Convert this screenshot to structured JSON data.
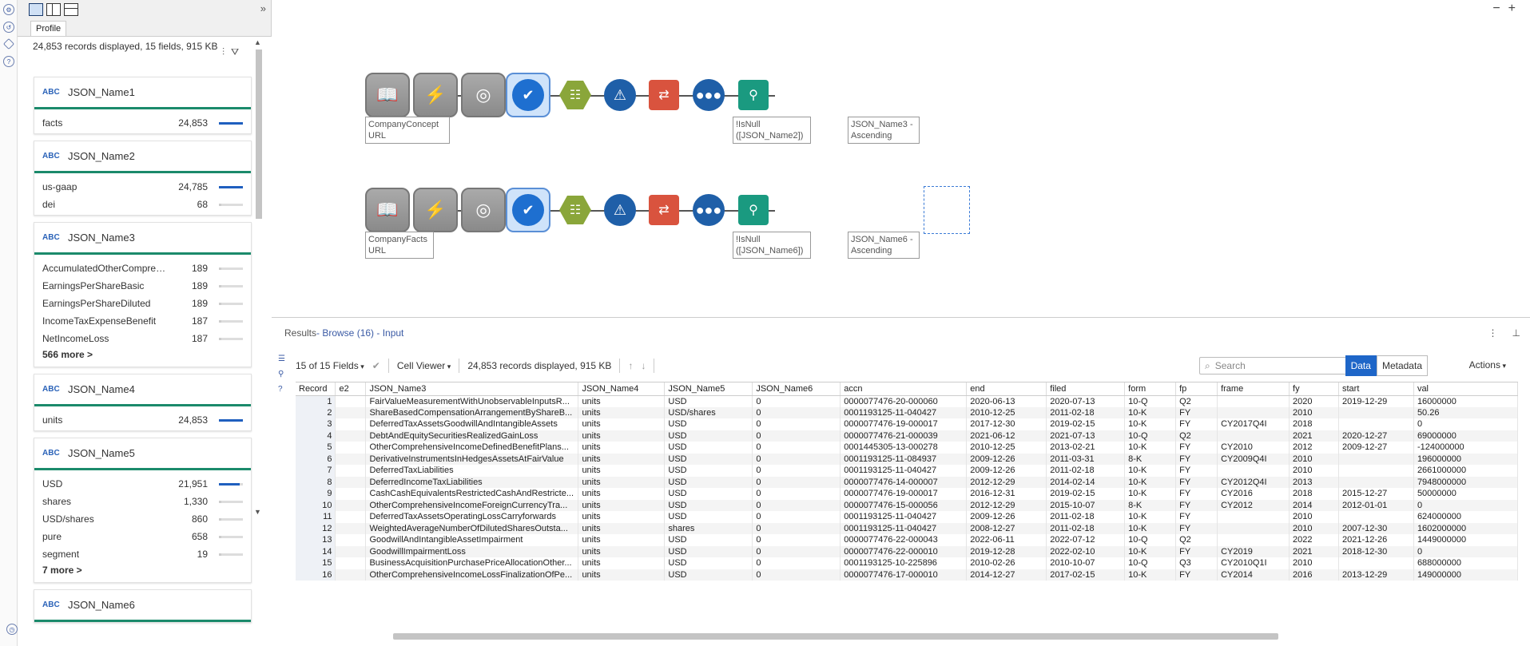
{
  "left_panel": {
    "tab": "Profile",
    "summary": "24,853 records displayed, 15 fields, 915 KB",
    "cards": [
      {
        "name": "JSON_Name1",
        "rows": [
          {
            "label": "facts",
            "count": "24,853",
            "pct": 1.0
          }
        ]
      },
      {
        "name": "JSON_Name2",
        "rows": [
          {
            "label": "us-gaap",
            "count": "24,785",
            "pct": 0.99
          },
          {
            "label": "dei",
            "count": "68",
            "pct": 0.1
          }
        ]
      },
      {
        "name": "JSON_Name3",
        "rows": [
          {
            "label": "AccumulatedOtherComprehens...",
            "count": "189",
            "pct": 0.1
          },
          {
            "label": "EarningsPerShareBasic",
            "count": "189",
            "pct": 0.1
          },
          {
            "label": "EarningsPerShareDiluted",
            "count": "189",
            "pct": 0.1
          },
          {
            "label": "IncomeTaxExpenseBenefit",
            "count": "187",
            "pct": 0.1
          },
          {
            "label": "NetIncomeLoss",
            "count": "187",
            "pct": 0.1
          }
        ],
        "more": "566 more >"
      },
      {
        "name": "JSON_Name4",
        "rows": [
          {
            "label": "units",
            "count": "24,853",
            "pct": 1.0
          }
        ]
      },
      {
        "name": "JSON_Name5",
        "rows": [
          {
            "label": "USD",
            "count": "21,951",
            "pct": 0.88
          },
          {
            "label": "shares",
            "count": "1,330",
            "pct": 0.1
          },
          {
            "label": "USD/shares",
            "count": "860",
            "pct": 0.1
          },
          {
            "label": "pure",
            "count": "658",
            "pct": 0.1
          },
          {
            "label": "segment",
            "count": "19",
            "pct": 0.1
          }
        ],
        "more": "7 more >"
      },
      {
        "name": "JSON_Name6",
        "rows": []
      }
    ]
  },
  "canvas": {
    "labels": {
      "t1": "CompanyConcept URL",
      "t2": "!IsNull ([JSON_Name2])",
      "t3": "JSON_Name3 - Ascending",
      "t4": "CompanyFacts URL",
      "t5": "!IsNull ([JSON_Name6])",
      "t6": "JSON_Name6 - Ascending"
    },
    "zoom_out": "−",
    "zoom_in": "+"
  },
  "results": {
    "title": "Results",
    "subtitle": " - Browse (16) - Input",
    "fields_selector": "15 of 15 Fields",
    "cell_viewer": "Cell Viewer",
    "records_info": "24,853 records displayed, 915 KB",
    "search_placeholder": "Search",
    "data_btn": "Data",
    "metadata_btn": "Metadata",
    "actions_btn": "Actions",
    "columns": [
      "Record",
      "e2",
      "JSON_Name3",
      "JSON_Name4",
      "JSON_Name5",
      "JSON_Name6",
      "accn",
      "end",
      "filed",
      "form",
      "fp",
      "frame",
      "fy",
      "start",
      "val"
    ],
    "rows": [
      [
        "1",
        "",
        "FairValueMeasurementWithUnobservableInputsR...",
        "units",
        "USD",
        "0",
        "0000077476-20-000060",
        "2020-06-13",
        "2020-07-13",
        "10-Q",
        "Q2",
        "",
        "2020",
        "2019-12-29",
        "16000000"
      ],
      [
        "2",
        "",
        "ShareBasedCompensationArrangementByShareB...",
        "units",
        "USD/shares",
        "0",
        "0001193125-11-040427",
        "2010-12-25",
        "2011-02-18",
        "10-K",
        "FY",
        "",
        "2010",
        "",
        "50.26"
      ],
      [
        "3",
        "",
        "DeferredTaxAssetsGoodwillAndIntangibleAssets",
        "units",
        "USD",
        "0",
        "0000077476-19-000017",
        "2017-12-30",
        "2019-02-15",
        "10-K",
        "FY",
        "CY2017Q4I",
        "2018",
        "",
        "0"
      ],
      [
        "4",
        "",
        "DebtAndEquitySecuritiesRealizedGainLoss",
        "units",
        "USD",
        "0",
        "0000077476-21-000039",
        "2021-06-12",
        "2021-07-13",
        "10-Q",
        "Q2",
        "",
        "2021",
        "2020-12-27",
        "69000000"
      ],
      [
        "5",
        "",
        "OtherComprehensiveIncomeDefinedBenefitPlans...",
        "units",
        "USD",
        "0",
        "0001445305-13-000278",
        "2010-12-25",
        "2013-02-21",
        "10-K",
        "FY",
        "CY2010",
        "2012",
        "2009-12-27",
        "-124000000"
      ],
      [
        "6",
        "",
        "DerivativeInstrumentsInHedgesAssetsAtFairValue",
        "units",
        "USD",
        "0",
        "0001193125-11-084937",
        "2009-12-26",
        "2011-03-31",
        "8-K",
        "FY",
        "CY2009Q4I",
        "2010",
        "",
        "196000000"
      ],
      [
        "7",
        "",
        "DeferredTaxLiabilities",
        "units",
        "USD",
        "0",
        "0001193125-11-040427",
        "2009-12-26",
        "2011-02-18",
        "10-K",
        "FY",
        "",
        "2010",
        "",
        "2661000000"
      ],
      [
        "8",
        "",
        "DeferredIncomeTaxLiabilities",
        "units",
        "USD",
        "0",
        "0000077476-14-000007",
        "2012-12-29",
        "2014-02-14",
        "10-K",
        "FY",
        "CY2012Q4I",
        "2013",
        "",
        "7948000000"
      ],
      [
        "9",
        "",
        "CashCashEquivalentsRestrictedCashAndRestricte...",
        "units",
        "USD",
        "0",
        "0000077476-19-000017",
        "2016-12-31",
        "2019-02-15",
        "10-K",
        "FY",
        "CY2016",
        "2018",
        "2015-12-27",
        "50000000"
      ],
      [
        "10",
        "",
        "OtherComprehensiveIncomeForeignCurrencyTra...",
        "units",
        "USD",
        "0",
        "0000077476-15-000056",
        "2012-12-29",
        "2015-10-07",
        "8-K",
        "FY",
        "CY2012",
        "2014",
        "2012-01-01",
        "0"
      ],
      [
        "11",
        "",
        "DeferredTaxAssetsOperatingLossCarryforwards",
        "units",
        "USD",
        "0",
        "0001193125-11-040427",
        "2009-12-26",
        "2011-02-18",
        "10-K",
        "FY",
        "",
        "2010",
        "",
        "624000000"
      ],
      [
        "12",
        "",
        "WeightedAverageNumberOfDilutedSharesOutsta...",
        "units",
        "shares",
        "0",
        "0001193125-11-040427",
        "2008-12-27",
        "2011-02-18",
        "10-K",
        "FY",
        "",
        "2010",
        "2007-12-30",
        "1602000000"
      ],
      [
        "13",
        "",
        "GoodwillAndIntangibleAssetImpairment",
        "units",
        "USD",
        "0",
        "0000077476-22-000043",
        "2022-06-11",
        "2022-07-12",
        "10-Q",
        "Q2",
        "",
        "2022",
        "2021-12-26",
        "1449000000"
      ],
      [
        "14",
        "",
        "GoodwillImpairmentLoss",
        "units",
        "USD",
        "0",
        "0000077476-22-000010",
        "2019-12-28",
        "2022-02-10",
        "10-K",
        "FY",
        "CY2019",
        "2021",
        "2018-12-30",
        "0"
      ],
      [
        "15",
        "",
        "BusinessAcquisitionPurchasePriceAllocationOther...",
        "units",
        "USD",
        "0",
        "0001193125-10-225896",
        "2010-02-26",
        "2010-10-07",
        "10-Q",
        "Q3",
        "CY2010Q1I",
        "2010",
        "",
        "688000000"
      ],
      [
        "16",
        "",
        "OtherComprehensiveIncomeLossFinalizationOfPe...",
        "units",
        "USD",
        "0",
        "0000077476-17-000010",
        "2014-12-27",
        "2017-02-15",
        "10-K",
        "FY",
        "CY2014",
        "2016",
        "2013-12-29",
        "149000000"
      ]
    ]
  },
  "colors": {
    "accent": "#1e66c8",
    "card_rule": "#1b8a6b"
  }
}
